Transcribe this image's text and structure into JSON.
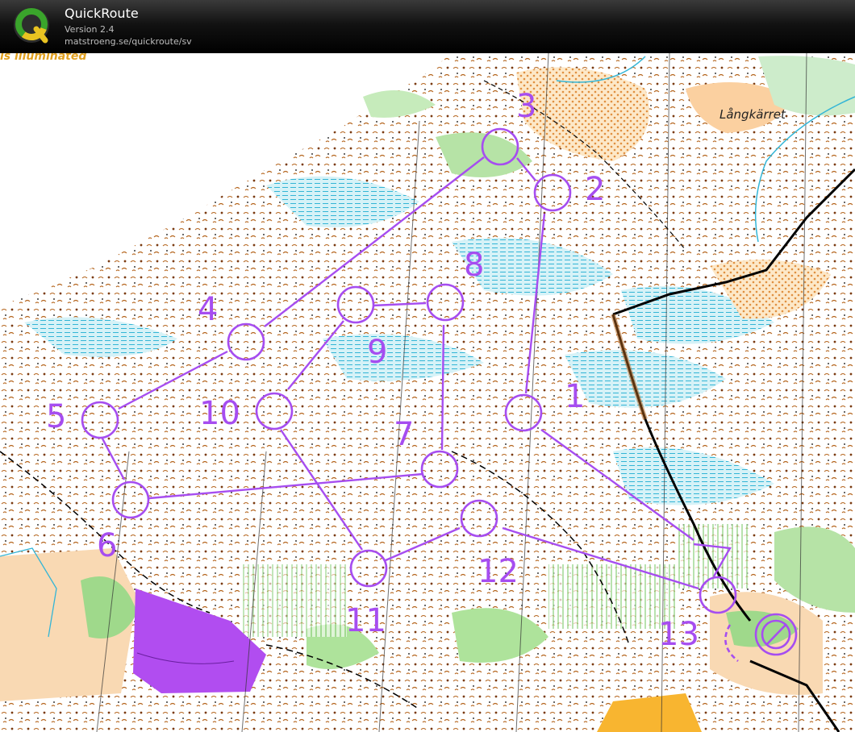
{
  "app": {
    "title": "QuickRoute",
    "version": "Version 2.4",
    "url": "matstroeng.se/quickroute/sv"
  },
  "map": {
    "fragment_text": "is illuminated",
    "place_name": "Långkärret",
    "course_color": "#a64df0",
    "controls": [
      {
        "label": "1"
      },
      {
        "label": "2"
      },
      {
        "label": "3"
      },
      {
        "label": "4"
      },
      {
        "label": "5"
      },
      {
        "label": "6"
      },
      {
        "label": "7"
      },
      {
        "label": "8"
      },
      {
        "label": "9"
      },
      {
        "label": "10"
      },
      {
        "label": "11"
      },
      {
        "label": "12"
      },
      {
        "label": "13"
      }
    ]
  }
}
